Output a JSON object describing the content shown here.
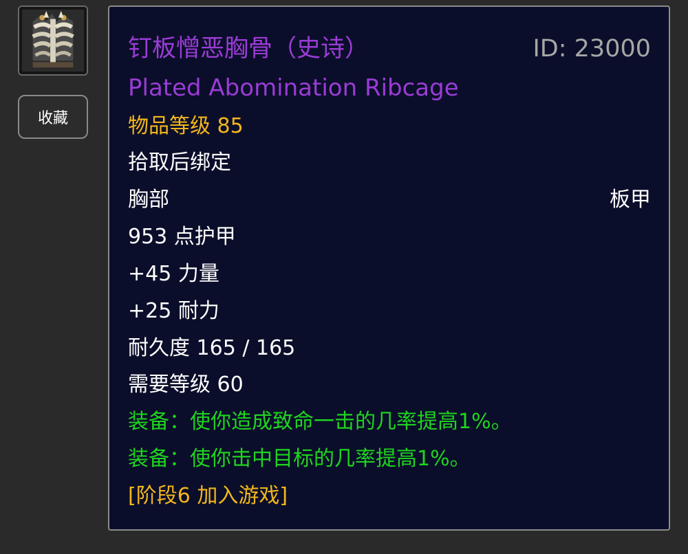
{
  "item": {
    "icon": "plated-ribcage-chest-armor-icon",
    "favorite_label": "收藏",
    "name_cn": "钉板憎恶胸骨（史诗）",
    "id_label": "ID: 23000",
    "name_en": "Plated Abomination Ribcage",
    "item_level": "物品等级 85",
    "bind": "拾取后绑定",
    "slot": "胸部",
    "armor_type": "板甲",
    "armor": "953 点护甲",
    "stat_strength": "+45 力量",
    "stat_stamina": "+25 耐力",
    "durability": "耐久度 165 / 165",
    "required_level": "需要等级 60",
    "equip_effects": [
      "装备：使你造成致命一击的几率提高1%。",
      "装备：使你击中目标的几率提高1%。"
    ],
    "phase": "[阶段6 加入游戏]"
  },
  "colors": {
    "epic": "#9a3cd6",
    "item_level": "#f3b71b",
    "equip_effect": "#1fd41f",
    "tooltip_bg": "#0b0e2a",
    "page_bg": "#2a2a2a"
  }
}
